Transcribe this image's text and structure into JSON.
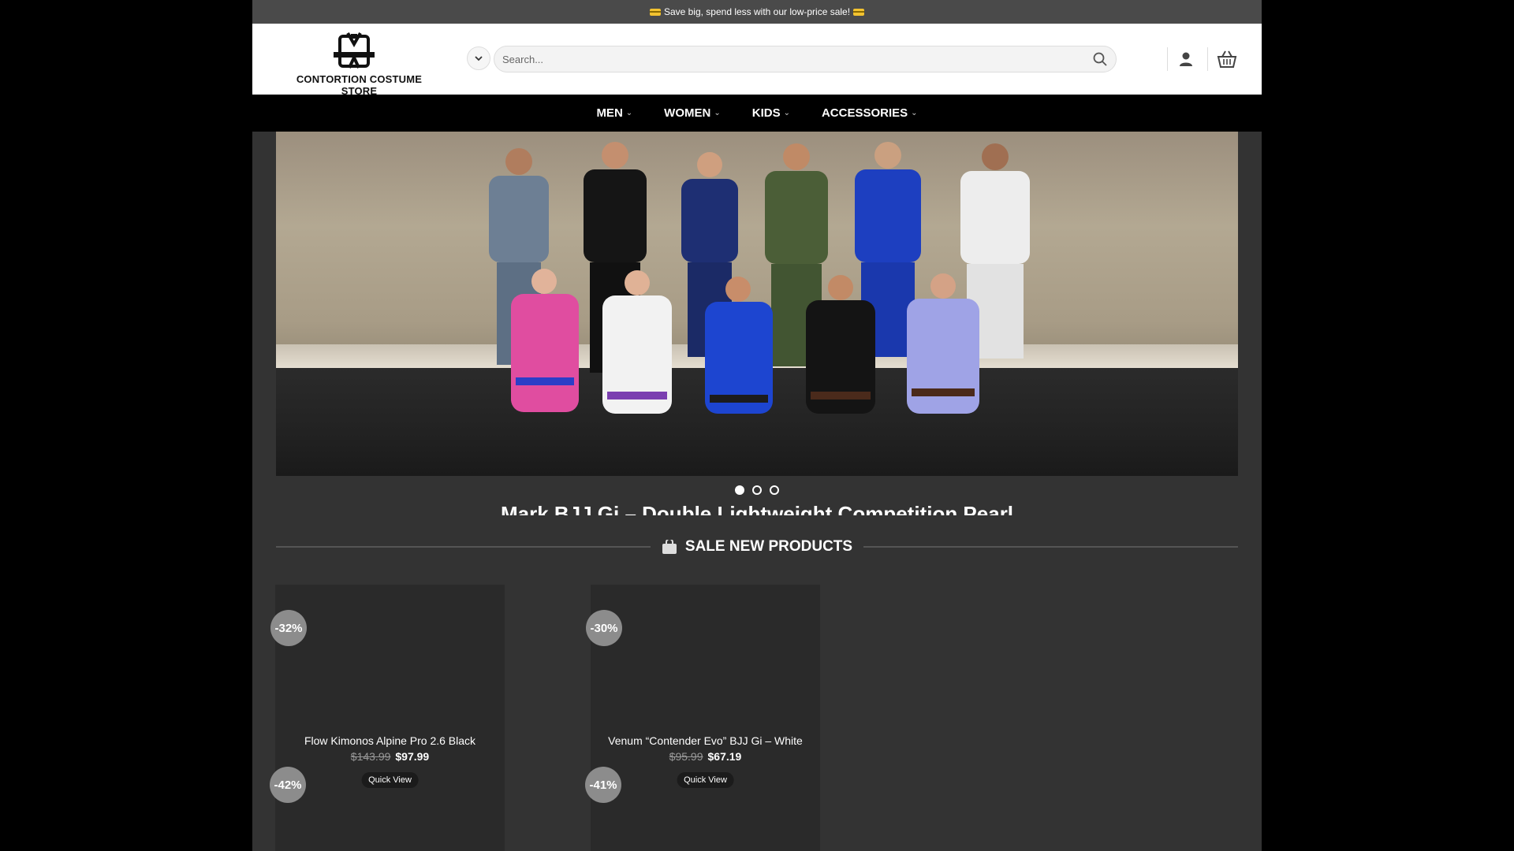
{
  "topbar": {
    "message": "Save big, spend less with our low-price sale!"
  },
  "header": {
    "store_name": "CONTORTION COSTUME STORE",
    "search": {
      "placeholder": "Search..."
    }
  },
  "nav": [
    {
      "label": "MEN"
    },
    {
      "label": "WOMEN"
    },
    {
      "label": "KIDS"
    },
    {
      "label": "ACCESSORIES"
    }
  ],
  "slider": {
    "active_index": 0,
    "dot_count": 3,
    "partial_title": "Mark BJJ Gi – Double Lightweight Competition Pearl"
  },
  "section": {
    "title": "SALE NEW PRODUCTS",
    "icon": "shopping-bag-icon"
  },
  "products": [
    {
      "badge": "-32%",
      "title": "Flow Kimonos Alpine Pro 2.6 Black",
      "old_price": "$143.99",
      "new_price": "$97.99",
      "quick_view": "Quick View"
    },
    {
      "badge": "-30%",
      "title": "Venum “Contender Evo” BJJ Gi – White",
      "old_price": "$95.99",
      "new_price": "$67.19",
      "quick_view": "Quick View"
    },
    {
      "badge": "-42%"
    },
    {
      "badge": "-41%"
    }
  ],
  "colors": {
    "page_bg": "#333333",
    "topbar_bg": "#4a4a4a",
    "nav_bg": "#000000",
    "badge_bg": "#8c8c8c"
  }
}
